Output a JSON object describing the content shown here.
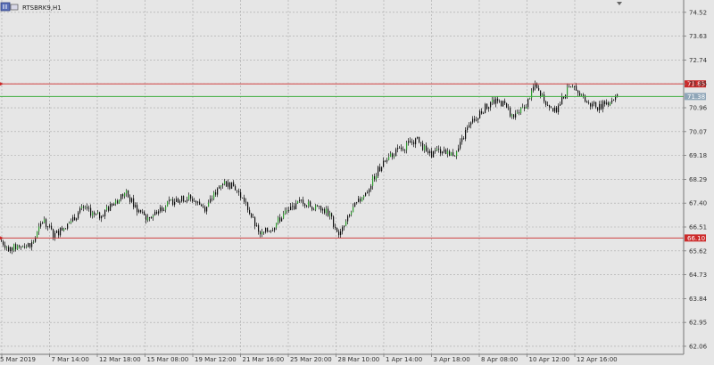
{
  "symbol_label": "RTSBRK9,H1",
  "colors": {
    "background": "#e6e6e6",
    "grid": "#a8a8a8",
    "frame": "#777777",
    "candle_body": "#111111",
    "bull_accent": "#2f9e2f",
    "resistance_line": "#cc2a2a",
    "support_line": "#cc2a2a",
    "price_line": "#3fae3f"
  },
  "icons": [
    "chart-window-icon",
    "one-click-trading-icon"
  ],
  "chart_data": {
    "type": "candlestick",
    "timeframe": "H1",
    "y_ticks": [
      "74.52",
      "73.63",
      "72.74",
      "71.85",
      "70.96",
      "70.07",
      "69.18",
      "68.29",
      "67.40",
      "66.51",
      "65.62",
      "64.73",
      "63.84",
      "62.95",
      "62.06"
    ],
    "x_ticks": [
      "5 Mar 2019",
      "7 Mar 14:00",
      "12 Mar 18:00",
      "15 Mar 08:00",
      "19 Mar 12:00",
      "21 Mar 16:00",
      "25 Mar 20:00",
      "28 Mar 10:00",
      "1 Apr 14:00",
      "3 Apr 18:00",
      "8 Apr 08:00",
      "10 Apr 12:00",
      "12 Apr 16:00"
    ],
    "ylim": [
      61.76,
      74.98
    ],
    "grid": true,
    "horizontal_levels": [
      {
        "name": "resistance",
        "value": 71.85,
        "tag": "71.85"
      },
      {
        "name": "current",
        "value": 71.38,
        "tag": "71.38"
      },
      {
        "name": "support",
        "value": 66.1,
        "tag": "66.10"
      }
    ],
    "price_path": [
      {
        "x": 0,
        "y": 66.0
      },
      {
        "x": 10,
        "y": 65.7
      },
      {
        "x": 22,
        "y": 65.8
      },
      {
        "x": 36,
        "y": 65.9
      },
      {
        "x": 48,
        "y": 66.8
      },
      {
        "x": 60,
        "y": 66.2
      },
      {
        "x": 75,
        "y": 66.6
      },
      {
        "x": 92,
        "y": 67.2
      },
      {
        "x": 110,
        "y": 66.9
      },
      {
        "x": 128,
        "y": 67.4
      },
      {
        "x": 140,
        "y": 67.8
      },
      {
        "x": 152,
        "y": 67.2
      },
      {
        "x": 165,
        "y": 66.8
      },
      {
        "x": 178,
        "y": 67.2
      },
      {
        "x": 195,
        "y": 67.5
      },
      {
        "x": 212,
        "y": 67.6
      },
      {
        "x": 230,
        "y": 67.2
      },
      {
        "x": 248,
        "y": 68.2
      },
      {
        "x": 262,
        "y": 68.0
      },
      {
        "x": 276,
        "y": 67.3
      },
      {
        "x": 290,
        "y": 66.2
      },
      {
        "x": 305,
        "y": 66.5
      },
      {
        "x": 320,
        "y": 67.1
      },
      {
        "x": 338,
        "y": 67.5
      },
      {
        "x": 352,
        "y": 67.2
      },
      {
        "x": 366,
        "y": 67.1
      },
      {
        "x": 380,
        "y": 66.2
      },
      {
        "x": 395,
        "y": 67.2
      },
      {
        "x": 410,
        "y": 67.8
      },
      {
        "x": 422,
        "y": 68.6
      },
      {
        "x": 438,
        "y": 69.2
      },
      {
        "x": 452,
        "y": 69.5
      },
      {
        "x": 466,
        "y": 69.8
      },
      {
        "x": 480,
        "y": 69.2
      },
      {
        "x": 495,
        "y": 69.4
      },
      {
        "x": 510,
        "y": 69.2
      },
      {
        "x": 522,
        "y": 70.1
      },
      {
        "x": 535,
        "y": 70.7
      },
      {
        "x": 550,
        "y": 71.2
      },
      {
        "x": 564,
        "y": 71.1
      },
      {
        "x": 575,
        "y": 70.6
      },
      {
        "x": 588,
        "y": 71.0
      },
      {
        "x": 598,
        "y": 71.8
      },
      {
        "x": 610,
        "y": 71.2
      },
      {
        "x": 622,
        "y": 70.8
      },
      {
        "x": 634,
        "y": 71.6
      },
      {
        "x": 646,
        "y": 71.7
      },
      {
        "x": 658,
        "y": 71.1
      },
      {
        "x": 670,
        "y": 71.0
      },
      {
        "x": 682,
        "y": 71.2
      },
      {
        "x": 692,
        "y": 71.4
      }
    ]
  }
}
